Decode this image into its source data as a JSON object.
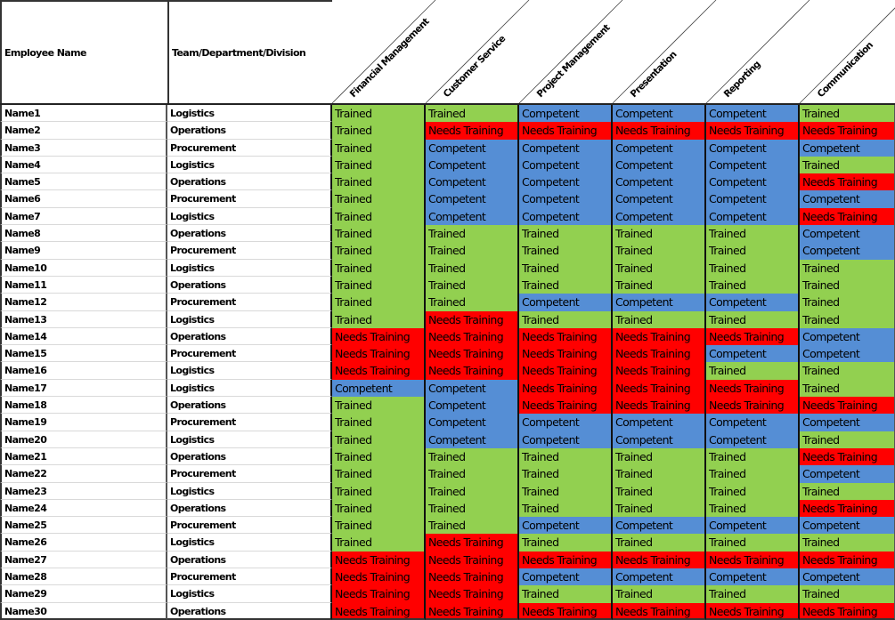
{
  "sheet": {
    "headers": {
      "employee_name": "Employee Name",
      "team": "Team/Department/Division",
      "skills": [
        "Financial Management",
        "Customer Service",
        "Project Management",
        "Presentation",
        "Reporting",
        "Communication"
      ]
    },
    "status_colors": {
      "Trained": "#92d050",
      "Competent": "#558ed5",
      "Needs Training": "#ff0000"
    },
    "rows": [
      {
        "name": "Name1",
        "team": "Logistics",
        "skills": [
          "Trained",
          "Trained",
          "Competent",
          "Competent",
          "Competent",
          "Trained"
        ]
      },
      {
        "name": "Name2",
        "team": "Operations",
        "skills": [
          "Trained",
          "Needs Training",
          "Needs Training",
          "Needs Training",
          "Needs Training",
          "Needs Training"
        ]
      },
      {
        "name": "Name3",
        "team": "Procurement",
        "skills": [
          "Trained",
          "Competent",
          "Competent",
          "Competent",
          "Competent",
          "Competent"
        ]
      },
      {
        "name": "Name4",
        "team": "Logistics",
        "skills": [
          "Trained",
          "Competent",
          "Competent",
          "Competent",
          "Competent",
          "Trained"
        ]
      },
      {
        "name": "Name5",
        "team": "Operations",
        "skills": [
          "Trained",
          "Competent",
          "Competent",
          "Competent",
          "Competent",
          "Needs Training"
        ]
      },
      {
        "name": "Name6",
        "team": "Procurement",
        "skills": [
          "Trained",
          "Competent",
          "Competent",
          "Competent",
          "Competent",
          "Competent"
        ]
      },
      {
        "name": "Name7",
        "team": "Logistics",
        "skills": [
          "Trained",
          "Competent",
          "Competent",
          "Competent",
          "Competent",
          "Needs Training"
        ]
      },
      {
        "name": "Name8",
        "team": "Operations",
        "skills": [
          "Trained",
          "Trained",
          "Trained",
          "Trained",
          "Trained",
          "Competent"
        ]
      },
      {
        "name": "Name9",
        "team": "Procurement",
        "skills": [
          "Trained",
          "Trained",
          "Trained",
          "Trained",
          "Trained",
          "Competent"
        ]
      },
      {
        "name": "Name10",
        "team": "Logistics",
        "skills": [
          "Trained",
          "Trained",
          "Trained",
          "Trained",
          "Trained",
          "Trained"
        ]
      },
      {
        "name": "Name11",
        "team": "Operations",
        "skills": [
          "Trained",
          "Trained",
          "Trained",
          "Trained",
          "Trained",
          "Trained"
        ]
      },
      {
        "name": "Name12",
        "team": "Procurement",
        "skills": [
          "Trained",
          "Trained",
          "Competent",
          "Competent",
          "Competent",
          "Trained"
        ]
      },
      {
        "name": "Name13",
        "team": "Logistics",
        "skills": [
          "Trained",
          "Needs Training",
          "Trained",
          "Trained",
          "Trained",
          "Trained"
        ]
      },
      {
        "name": "Name14",
        "team": "Operations",
        "skills": [
          "Needs Training",
          "Needs Training",
          "Needs Training",
          "Needs Training",
          "Needs Training",
          "Competent"
        ]
      },
      {
        "name": "Name15",
        "team": "Procurement",
        "skills": [
          "Needs Training",
          "Needs Training",
          "Needs Training",
          "Needs Training",
          "Competent",
          "Competent"
        ]
      },
      {
        "name": "Name16",
        "team": "Logistics",
        "skills": [
          "Needs Training",
          "Needs Training",
          "Needs Training",
          "Needs Training",
          "Trained",
          "Trained"
        ]
      },
      {
        "name": "Name17",
        "team": "Logistics",
        "skills": [
          "Competent",
          "Competent",
          "Needs Training",
          "Needs Training",
          "Needs Training",
          "Trained"
        ]
      },
      {
        "name": "Name18",
        "team": "Operations",
        "skills": [
          "Trained",
          "Competent",
          "Needs Training",
          "Needs Training",
          "Needs Training",
          "Needs Training"
        ]
      },
      {
        "name": "Name19",
        "team": "Procurement",
        "skills": [
          "Trained",
          "Competent",
          "Competent",
          "Competent",
          "Competent",
          "Competent"
        ]
      },
      {
        "name": "Name20",
        "team": "Logistics",
        "skills": [
          "Trained",
          "Competent",
          "Competent",
          "Competent",
          "Competent",
          "Trained"
        ]
      },
      {
        "name": "Name21",
        "team": "Operations",
        "skills": [
          "Trained",
          "Trained",
          "Trained",
          "Trained",
          "Trained",
          "Needs Training"
        ]
      },
      {
        "name": "Name22",
        "team": "Procurement",
        "skills": [
          "Trained",
          "Trained",
          "Trained",
          "Trained",
          "Trained",
          "Competent"
        ]
      },
      {
        "name": "Name23",
        "team": "Logistics",
        "skills": [
          "Trained",
          "Trained",
          "Trained",
          "Trained",
          "Trained",
          "Trained"
        ]
      },
      {
        "name": "Name24",
        "team": "Operations",
        "skills": [
          "Trained",
          "Trained",
          "Trained",
          "Trained",
          "Trained",
          "Needs Training"
        ]
      },
      {
        "name": "Name25",
        "team": "Procurement",
        "skills": [
          "Trained",
          "Trained",
          "Competent",
          "Competent",
          "Competent",
          "Competent"
        ]
      },
      {
        "name": "Name26",
        "team": "Logistics",
        "skills": [
          "Trained",
          "Needs Training",
          "Trained",
          "Trained",
          "Trained",
          "Trained"
        ]
      },
      {
        "name": "Name27",
        "team": "Operations",
        "skills": [
          "Needs Training",
          "Needs Training",
          "Needs Training",
          "Needs Training",
          "Needs Training",
          "Needs Training"
        ]
      },
      {
        "name": "Name28",
        "team": "Procurement",
        "skills": [
          "Needs Training",
          "Needs Training",
          "Competent",
          "Competent",
          "Competent",
          "Competent"
        ]
      },
      {
        "name": "Name29",
        "team": "Logistics",
        "skills": [
          "Needs Training",
          "Needs Training",
          "Trained",
          "Trained",
          "Trained",
          "Trained"
        ]
      },
      {
        "name": "Name30",
        "team": "Operations",
        "skills": [
          "Needs Training",
          "Needs Training",
          "Needs Training",
          "Needs Training",
          "Needs Training",
          "Needs Training"
        ]
      }
    ]
  }
}
